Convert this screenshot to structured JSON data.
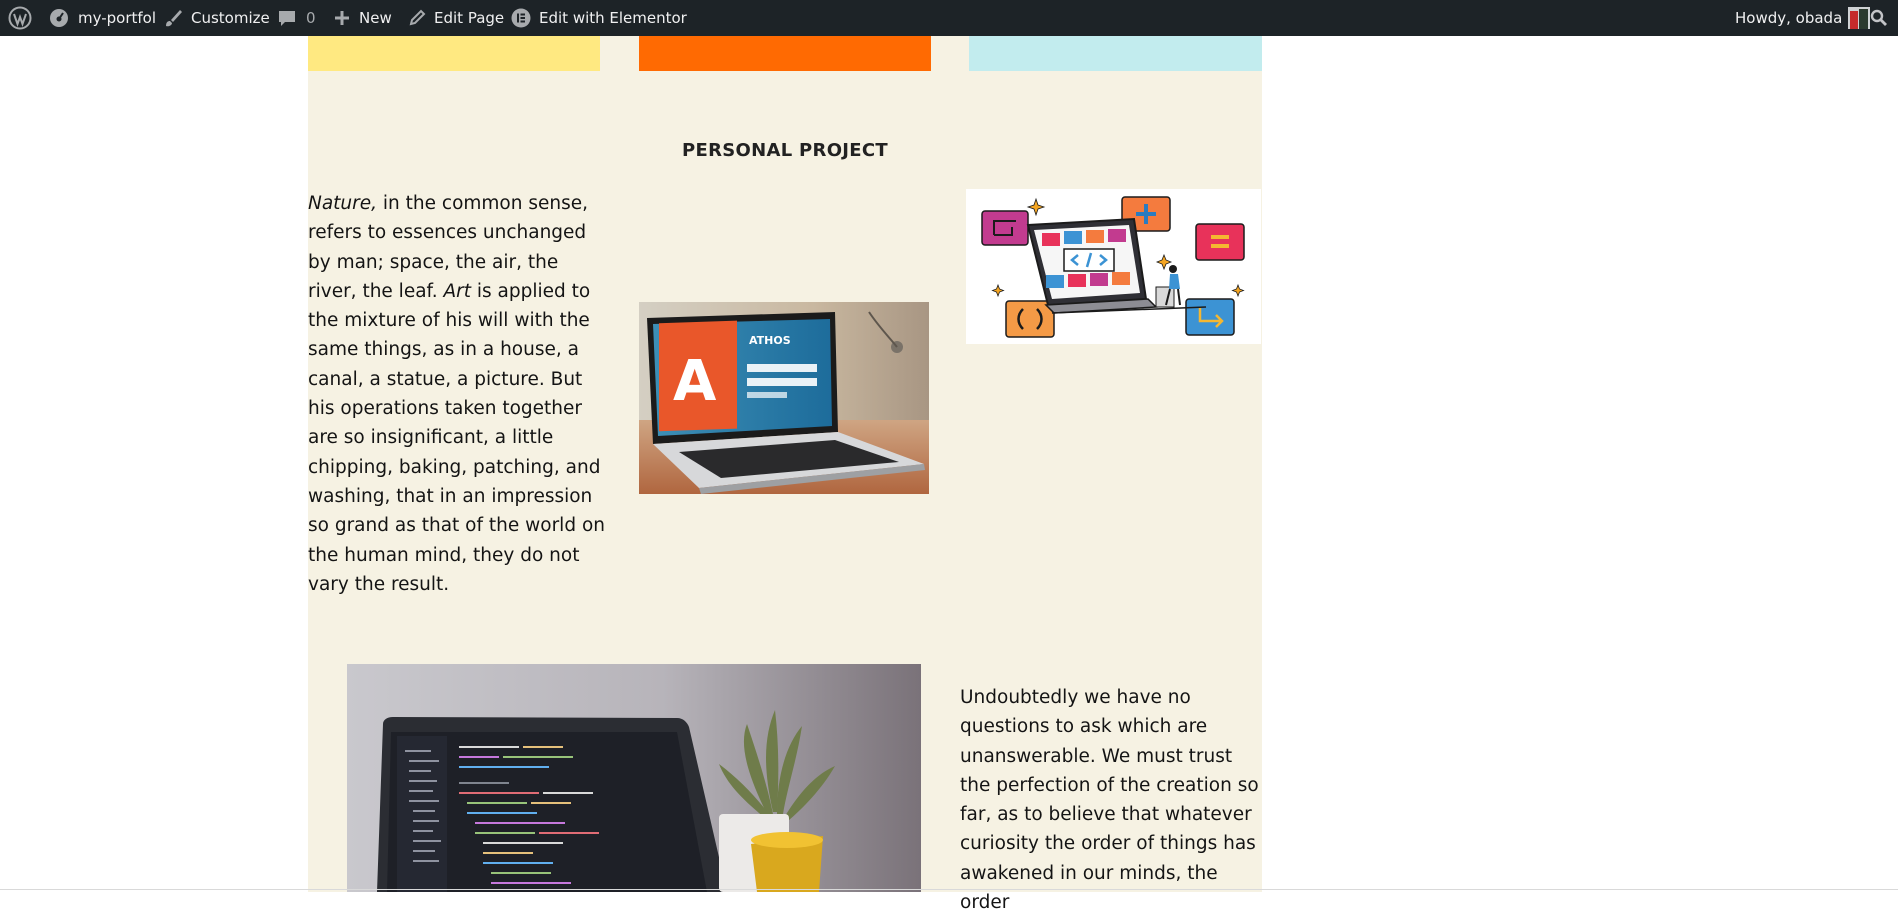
{
  "admin_bar": {
    "site_name": "my-portfol",
    "customize": "Customize",
    "comments_count": "0",
    "new": "New",
    "edit_page": "Edit Page",
    "edit_with_elementor": "Edit with Elementor",
    "howdy": "Howdy, obada",
    "icons": [
      "wordpress-icon",
      "dashboard-icon",
      "brush-icon",
      "comment-icon",
      "plus-icon",
      "pencil-icon",
      "elementor-icon",
      "avatar",
      "search-icon"
    ]
  },
  "colors": {
    "admin_bar_bg": "#1d2327",
    "content_bg": "#f6f2e3",
    "block_yellow": "#ffe981",
    "block_orange": "#ff6a02",
    "block_cyan": "#c2ecee"
  },
  "section": {
    "title": "PERSONAL PROJECT"
  },
  "left_paragraph": {
    "word1": "Nature,",
    "text1": " in the common sense, refers to essences unchanged by man; space, the air, the river, the leaf. ",
    "word2": "Art",
    "text2": " is applied to the mixture of his will with the same things, as in a house, a canal, a statue, a picture. But his operations taken together are so insignificant, a little chipping, baking, patching, and washing, that in an impression so grand as that of the world on the human mind, they do not vary the result."
  },
  "right_paragraph": {
    "text": "Undoubtedly we have no questions to ask which are unanswerable. We must trust the perfection of the creation so far, as to believe that whatever curiosity the order of things has awakened in our minds, the order"
  },
  "laptop_screen": {
    "brand": "ATHOS",
    "letter": "A"
  }
}
